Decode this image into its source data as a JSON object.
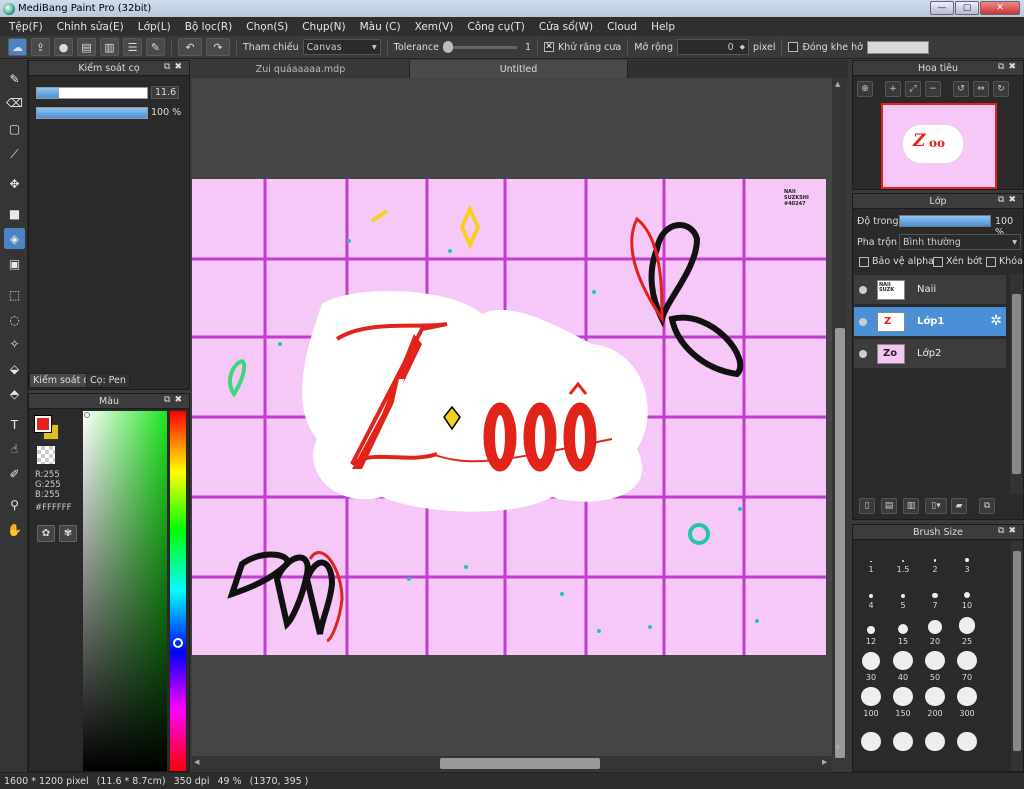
{
  "window": {
    "title": "MediBang Paint Pro (32bit)",
    "controls": [
      "—",
      "▢",
      "✕"
    ]
  },
  "menu": [
    "Tệp(F)",
    "Chỉnh sửa(E)",
    "Lớp(L)",
    "Bộ lọc(R)",
    "Chọn(S)",
    "Chụp(N)",
    "Màu (C)",
    "Xem(V)",
    "Công cụ(T)",
    "Cửa sổ(W)",
    "Cloud",
    "Help"
  ],
  "toolbar": {
    "tham_chieu_label": "Tham chiếu",
    "canvas_value": "Canvas",
    "tolerance_label": "Tolerance",
    "tolerance_value": "1",
    "tolerance_level": 0.0,
    "antialias_label": "Khử răng cưa",
    "antialias_checked": true,
    "expand_label": "Mở rộng",
    "expand_value": "0",
    "pixel_label": "pixel",
    "close_gap_label": "Đóng khe hở",
    "close_gap_checked": false,
    "dropdown_glyph": "▾",
    "check_glyph": "✕"
  },
  "brush_control": {
    "title": "Kiểm soát cọ",
    "size_value": "11.6",
    "size_fraction": 0.2,
    "opacity_value": "100 %",
    "opacity_fraction": 1.0,
    "tabs": [
      "Kiểm soát cọ",
      "Cọ: Pen"
    ]
  },
  "color_panel": {
    "title": "Màu",
    "r": "R:255",
    "g": "G:255",
    "b": "B:255",
    "hex": "#FFFFFF",
    "primary_color": "#e2231a",
    "secondary_color": "#e0c020"
  },
  "document_tabs": [
    "Zui quáaaaaa.mdp",
    "Untitled"
  ],
  "active_tab": 1,
  "canvas_art": {
    "watermark_lines": [
      "NAII",
      "SUZKSHI",
      "#40247"
    ],
    "background": "#f6c8f7",
    "grid_color": "#c23cd0",
    "lettering_color": "#e2231a"
  },
  "navigator": {
    "title": "Hoa tiêu"
  },
  "layers_panel": {
    "title": "Lớp",
    "opacity_label": "Độ trong",
    "opacity_value": "100 %",
    "opacity_fraction": 1.0,
    "blend_label": "Pha trộn",
    "blend_value": "Bình thường",
    "checkboxes": [
      "Bảo vệ alpha",
      "Xén bớt",
      "Khóa"
    ],
    "layers": [
      {
        "name": "Naii",
        "selected": false
      },
      {
        "name": "Lớp1",
        "selected": true
      },
      {
        "name": "Lớp2",
        "selected": false
      }
    ]
  },
  "brush_size": {
    "title": "Brush Size",
    "sizes": [
      "1",
      "1.5",
      "2",
      "3",
      "4",
      "5",
      "7",
      "10",
      "12",
      "15",
      "20",
      "25",
      "30",
      "40",
      "50",
      "70",
      "100",
      "150",
      "200",
      "300",
      "",
      "",
      "",
      ""
    ]
  },
  "status": {
    "dimensions": "1600 * 1200 pixel",
    "physical": "(11.6 * 8.7cm)",
    "dpi": "350 dpi",
    "zoom": "49 %",
    "cursor": "(1370, 395 )"
  }
}
